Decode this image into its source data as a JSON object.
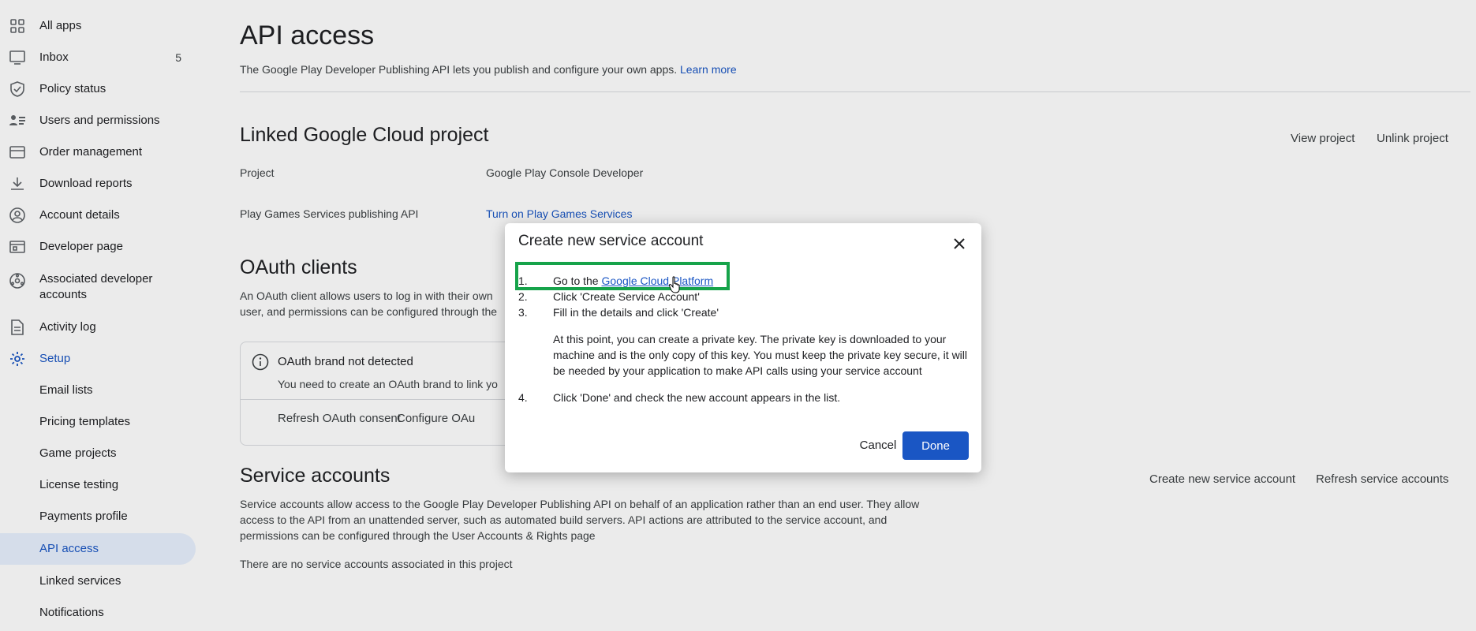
{
  "sidebar": {
    "items": [
      {
        "label": "All apps",
        "icon": "grid-icon"
      },
      {
        "label": "Inbox",
        "icon": "inbox-icon",
        "count": "5"
      },
      {
        "label": "Policy status",
        "icon": "shield-icon"
      },
      {
        "label": "Users and permissions",
        "icon": "users-icon"
      },
      {
        "label": "Order management",
        "icon": "credit-card-icon"
      },
      {
        "label": "Download reports",
        "icon": "download-icon"
      },
      {
        "label": "Account details",
        "icon": "account-circle-icon"
      },
      {
        "label": "Developer page",
        "icon": "web-page-icon"
      },
      {
        "label": "Associated developer accounts",
        "icon": "linked-accounts-icon"
      },
      {
        "label": "Activity log",
        "icon": "document-icon"
      },
      {
        "label": "Setup",
        "icon": "gear-icon"
      }
    ],
    "setup_items": [
      {
        "label": "Email lists"
      },
      {
        "label": "Pricing templates"
      },
      {
        "label": "Game projects"
      },
      {
        "label": "License testing"
      },
      {
        "label": "Payments profile"
      },
      {
        "label": "API access"
      },
      {
        "label": "Linked services"
      },
      {
        "label": "Notifications"
      }
    ]
  },
  "page": {
    "title": "API access",
    "intro": "The Google Play Developer Publishing API lets you publish and configure your own apps.",
    "learn_more": "Learn more"
  },
  "linked_project": {
    "heading": "Linked Google Cloud project",
    "view_project": "View project",
    "unlink_project": "Unlink project",
    "project_label": "Project",
    "project_value": "Google Play Console Developer",
    "games_label": "Play Games Services publishing API",
    "games_link": "Turn on Play Games Services"
  },
  "oauth": {
    "heading": "OAuth clients",
    "desc_line1": "An OAuth client allows users to log in with their own",
    "desc_line2": "user, and permissions can be configured through the",
    "brand_title": "OAuth brand not detected",
    "brand_desc": "You need to create an OAuth brand to link yo",
    "refresh_consent": "Refresh OAuth consent",
    "configure": "Configure OAu"
  },
  "service_accounts": {
    "heading": "Service accounts",
    "create": "Create new service account",
    "refresh": "Refresh service accounts",
    "desc_line1": "Service accounts allow access to the Google Play Developer Publishing API on behalf of an application rather than an end user. They allow",
    "desc_line2": "access to the API from an unattended server, such as automated build servers. API actions are attributed to the service account, and",
    "desc_line3": "permissions can be configured through the User Accounts & Rights page",
    "empty": "There are no service accounts associated in this project"
  },
  "dialog": {
    "title": "Create new service account",
    "step1_num": "1.",
    "step1_prefix": "Go to the",
    "step1_link": "Google Cloud Platform",
    "step2_num": "2.",
    "step2": "Click 'Create Service Account'",
    "step3_num": "3.",
    "step3": "Fill in the details and click 'Create'",
    "para_line1": "At this point, you can create a private key. The private key is downloaded to your",
    "para_line2": "machine and is the only copy of this key. You must keep the private key secure, it will",
    "para_line3": "be needed by your application to make API calls using your service account",
    "step4_num": "4.",
    "step4": "Click 'Done' and check the new account appears in the list.",
    "cancel": "Cancel",
    "done": "Done"
  },
  "colors": {
    "accent": "#1a56c4",
    "highlight": "#16a34a"
  }
}
